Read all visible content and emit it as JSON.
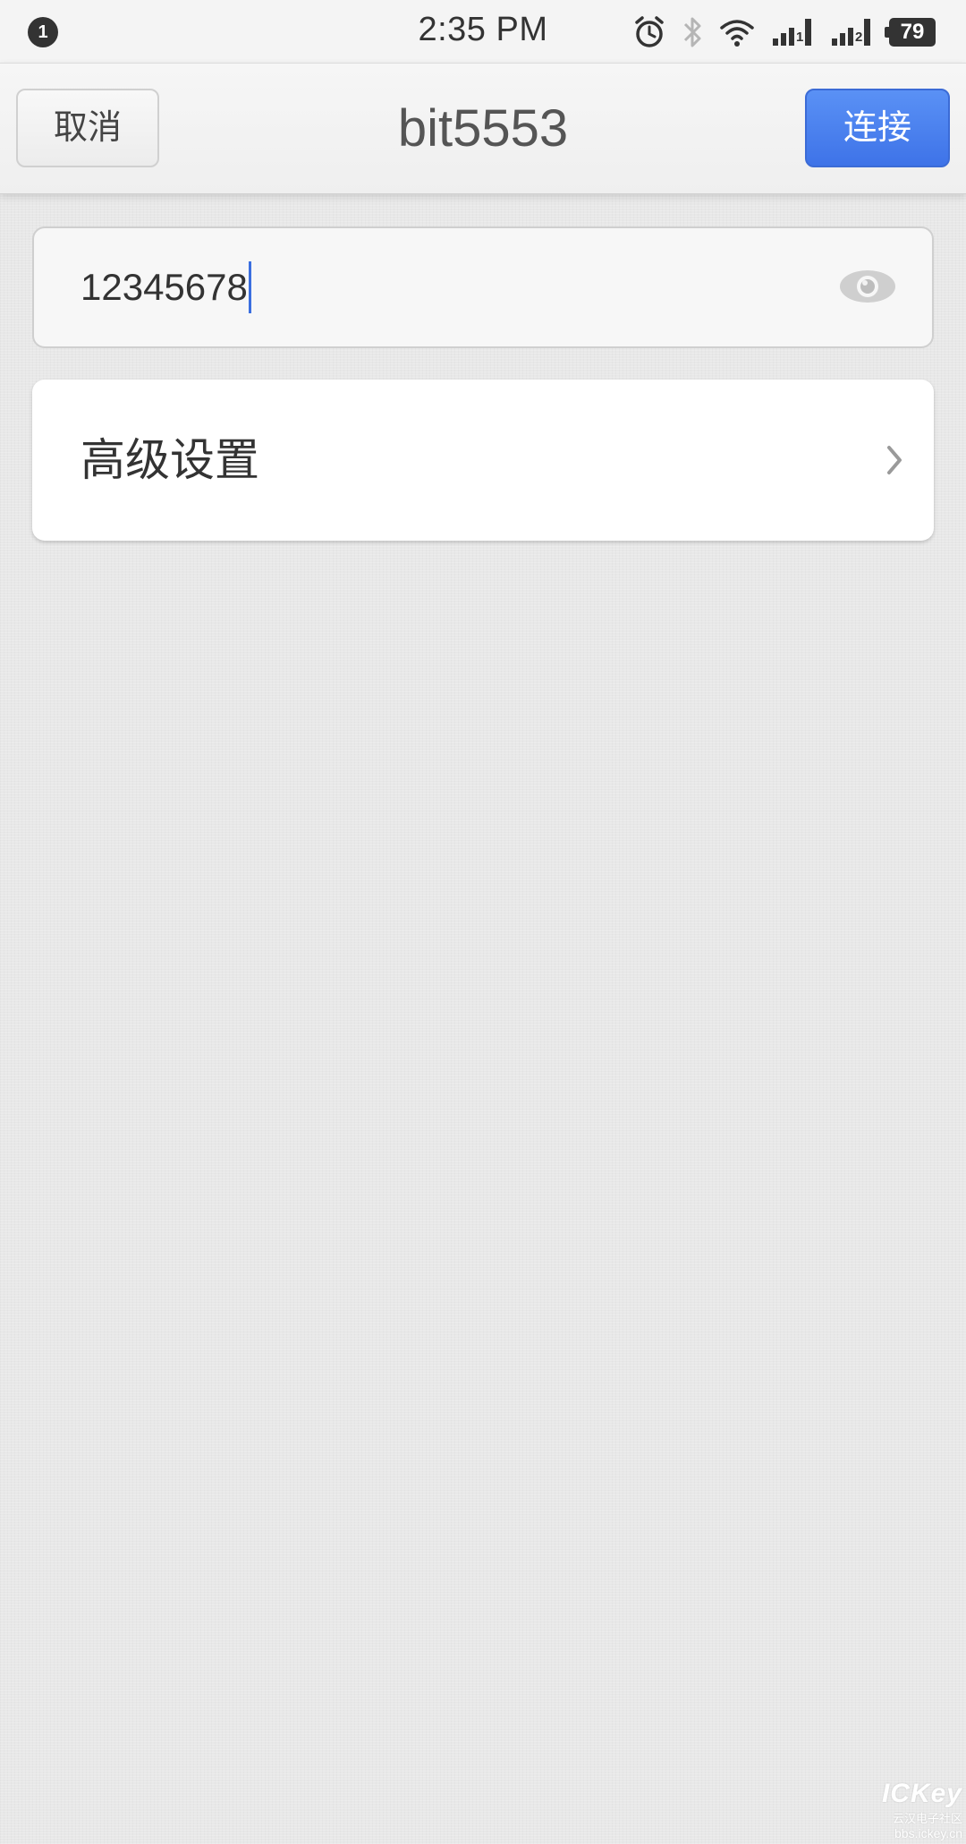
{
  "status_bar": {
    "notification_count": "1",
    "time": "2:35 PM",
    "battery": "79",
    "sim1_label": "1",
    "sim2_label": "2",
    "icons": [
      "alarm-icon",
      "bluetooth-icon",
      "wifi-icon",
      "signal-sim1-icon",
      "signal-sim2-icon",
      "battery-icon"
    ]
  },
  "header": {
    "cancel_label": "取消",
    "title": "bit5553",
    "connect_label": "连接"
  },
  "password": {
    "value": "12345678",
    "toggle_icon": "eye-icon"
  },
  "advanced": {
    "label": "高级设置",
    "icon": "chevron-right-icon"
  },
  "watermark": {
    "logo": "ICKey",
    "subtitle": "云汉电子社区",
    "url": "bbs.ickey.cn"
  },
  "colors": {
    "accent": "#4a80ee",
    "background": "#e8e8e8",
    "caret": "#3b6fe0"
  }
}
